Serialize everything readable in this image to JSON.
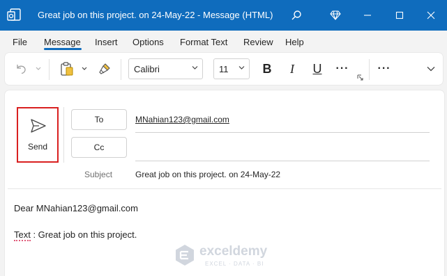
{
  "window": {
    "title": "Great job on this project. on 24-May-22  -  Message (HTML)",
    "accent": "#0f6cbd"
  },
  "icons": {
    "app": "outlook-compose-icon",
    "search": "search-icon",
    "premium": "diamond-icon",
    "minimize": "minimize-icon",
    "maximize": "maximize-icon",
    "close": "close-icon"
  },
  "menu": {
    "items": [
      "File",
      "Message",
      "Insert",
      "Options",
      "Format Text",
      "Review",
      "Help"
    ],
    "active": "Message"
  },
  "ribbon": {
    "font_name": "Calibri",
    "font_size": "11",
    "bold": "B",
    "italic": "I",
    "underline": "U",
    "more": "···",
    "more2": "···"
  },
  "compose": {
    "send_label": "Send",
    "to_label": "To",
    "cc_label": "Cc",
    "to_value": "MNahian123@gmail.com",
    "cc_value": "",
    "subject_label": "Subject",
    "subject_value": "Great job on this project. on 24-May-22",
    "body_line1": "Dear MNahian123@gmail.com",
    "body_line2_word": "Text",
    "body_line2_rest": " : Great job on this project."
  },
  "watermark": {
    "name": "exceldemy",
    "tagline": "EXCEL · DATA · BI"
  }
}
